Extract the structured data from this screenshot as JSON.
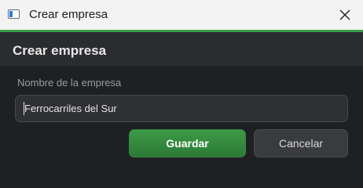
{
  "window": {
    "title": "Crear empresa",
    "icon": "app-window-icon"
  },
  "dialog": {
    "heading": "Crear empresa",
    "field": {
      "label": "Nombre de la empresa",
      "value": "Ferrocarriles del Sur"
    },
    "buttons": {
      "save": "Guardar",
      "cancel": "Cancelar"
    }
  },
  "colors": {
    "accent": "#3f9c4a",
    "primary_button": "#2f8a3b",
    "background": "#1f2022",
    "header": "#2b2c2f",
    "titlebar": "#f3f3f3"
  }
}
